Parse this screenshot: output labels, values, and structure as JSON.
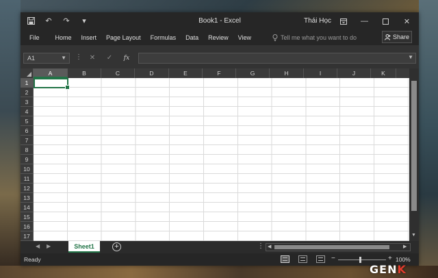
{
  "title_bar": {
    "document_title": "Book1 - Excel",
    "user_name": "Thái Học",
    "quick_access": [
      "save-icon",
      "undo-icon",
      "redo-icon",
      "customize-qat-icon"
    ]
  },
  "ribbon": {
    "tabs": [
      "File",
      "Home",
      "Insert",
      "Page Layout",
      "Formulas",
      "Data",
      "Review",
      "View"
    ],
    "tell_me_placeholder": "Tell me what you want to do",
    "share_label": "Share"
  },
  "formula_bar": {
    "name_box": "A1",
    "fx_label": "fx",
    "cancel_symbol": "✕",
    "enter_symbol": "✓",
    "formula_value": ""
  },
  "grid": {
    "columns": [
      "A",
      "B",
      "C",
      "D",
      "E",
      "F",
      "G",
      "H",
      "I",
      "J",
      "K"
    ],
    "rows": [
      "1",
      "2",
      "3",
      "4",
      "5",
      "6",
      "7",
      "8",
      "9",
      "10",
      "11",
      "12",
      "13",
      "14",
      "15",
      "16",
      "17"
    ],
    "active_cell": "A1"
  },
  "sheets": {
    "tabs": [
      "Sheet1"
    ],
    "active": "Sheet1",
    "add_symbol": "+"
  },
  "status_bar": {
    "status": "Ready",
    "zoom": "100%",
    "zoom_minus": "−",
    "zoom_plus": "+"
  },
  "colors": {
    "excel_green": "#217346",
    "dark_chrome": "#262626",
    "grid_line": "#dadada"
  },
  "watermark": {
    "text_main": "GEN",
    "text_accent": "K"
  }
}
